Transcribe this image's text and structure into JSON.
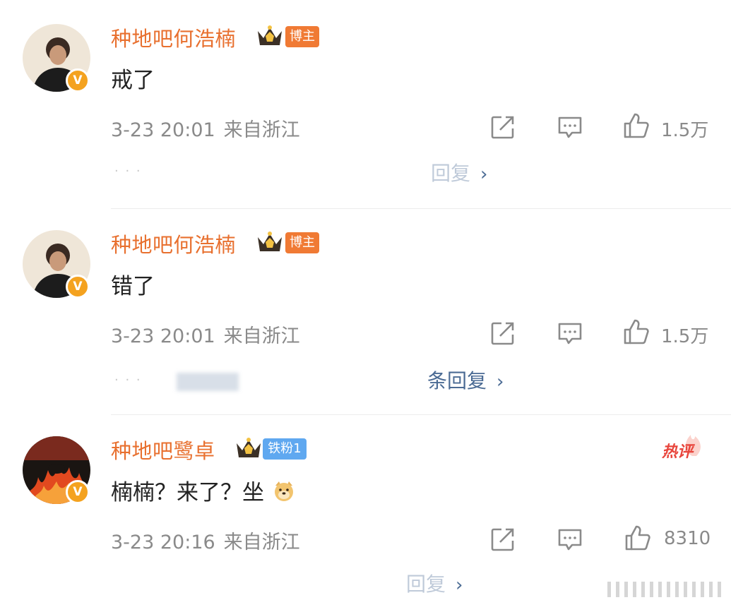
{
  "comments": [
    {
      "name": "种地吧何浩楠",
      "badge": "博主",
      "text": "戒了",
      "time": "3-23 20:01",
      "location": "来自浙江",
      "likes": "1.5万",
      "replies": "回复"
    },
    {
      "name": "种地吧何浩楠",
      "badge": "博主",
      "text": "错了",
      "time": "3-23 20:01",
      "location": "来自浙江",
      "likes": "1.5万",
      "replies": "条回复"
    },
    {
      "name": "种地吧鹭卓",
      "badge": "铁粉1",
      "text": "楠楠？来了？坐",
      "time": "3-23 20:16",
      "location": "来自浙江",
      "likes": "8310",
      "replies": "回复",
      "hot_label": "热评"
    }
  ],
  "colors": {
    "name": "#e8702f",
    "host_tag": "#f07a34",
    "fan_tag": "#5fa8f0",
    "meta": "#8a8a8a",
    "reply_link": "#4b6b94",
    "hot": "#e8453c"
  },
  "icons": [
    "share-icon",
    "comment-icon",
    "like-icon",
    "chevron-right-icon",
    "verified-v-icon",
    "crown-icon",
    "doge-emoji-icon"
  ]
}
